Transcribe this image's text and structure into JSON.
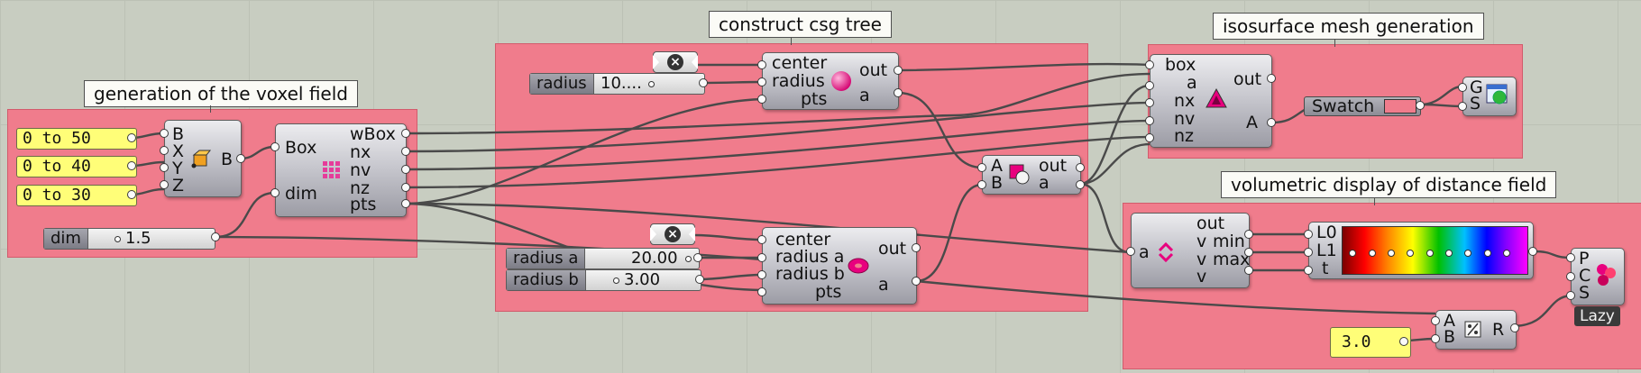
{
  "groups": {
    "voxel": {
      "label": "generation of the voxel field",
      "color": "#f07c8c"
    },
    "csg": {
      "label": "construct csg tree",
      "color": "#f07c8c"
    },
    "iso": {
      "label": "isosurface mesh generation",
      "color": "#f07c8c"
    },
    "vol": {
      "label": "volumetric display of distance field",
      "color": "#f07c8c"
    }
  },
  "panels": {
    "p1": "0 to 50",
    "p2": "0 to 40",
    "p3": "0 to 30",
    "p4": "3.0"
  },
  "sliders": {
    "dim": {
      "label": "dim",
      "value": "1.5"
    },
    "radius": {
      "label": "radius",
      "value": "10...."
    },
    "radius_a": {
      "label": "radius a",
      "value": "20.00"
    },
    "radius_b": {
      "label": "radius b",
      "value": "3.00"
    }
  },
  "components": {
    "box": {
      "inputs": [
        "B",
        "X",
        "Y",
        "Z"
      ],
      "outputs": [
        "B"
      ]
    },
    "voxel": {
      "inputs": [
        "Box",
        "dim"
      ],
      "outputs": [
        "wBox",
        "nx",
        "nv",
        "nz",
        "pts"
      ]
    },
    "sphere": {
      "inputs": [
        "center",
        "radius",
        "pts"
      ],
      "outputs": [
        "out",
        "a"
      ]
    },
    "torus": {
      "inputs": [
        "center",
        "radius_a",
        "radius_b",
        "pts"
      ],
      "outputs": [
        "out",
        "a"
      ]
    },
    "union": {
      "inputs": [
        "A",
        "B"
      ],
      "outputs": [
        "out",
        "a"
      ]
    },
    "iso": {
      "inputs": [
        "box",
        "a",
        "nx",
        "nv",
        "nz"
      ],
      "outputs": [
        "out",
        "A"
      ]
    },
    "gs": {
      "inputs": [
        "G",
        "S"
      ]
    },
    "bounds": {
      "inputs": [
        "a"
      ],
      "outputs": [
        "out",
        "v",
        "min",
        "v",
        "max",
        "v"
      ]
    },
    "gradient": {
      "inputs": [
        "L0",
        "L1",
        "t"
      ]
    },
    "preview": {
      "inputs": [
        "P",
        "C",
        "S"
      ],
      "badge": "Lazy"
    },
    "div": {
      "inputs": [
        "A",
        "B"
      ],
      "outputs": [
        "R"
      ]
    }
  },
  "swatch": {
    "label": "Swatch",
    "color": "#f07c8c"
  },
  "colors": {
    "canvas": "#c8cdc1",
    "group": "#f07c8c",
    "panel": "#fffe78",
    "wire": "#4a4a4a",
    "gradient": [
      "#8b0000",
      "#ff0000",
      "#ff8000",
      "#ffff00",
      "#00c000",
      "#00c0ff",
      "#0000ff",
      "#8000ff",
      "#ff00ff"
    ]
  },
  "icons": {
    "box": "box-component-icon",
    "voxel": "voxel-grid-icon",
    "sphere": "sphere-icon",
    "torus": "torus-icon",
    "union": "union-icon",
    "iso": "isosurface-icon",
    "gs": "custom-preview-icon",
    "bounds": "bounds-icon",
    "div": "division-icon",
    "preview": "preview-dots-icon"
  }
}
